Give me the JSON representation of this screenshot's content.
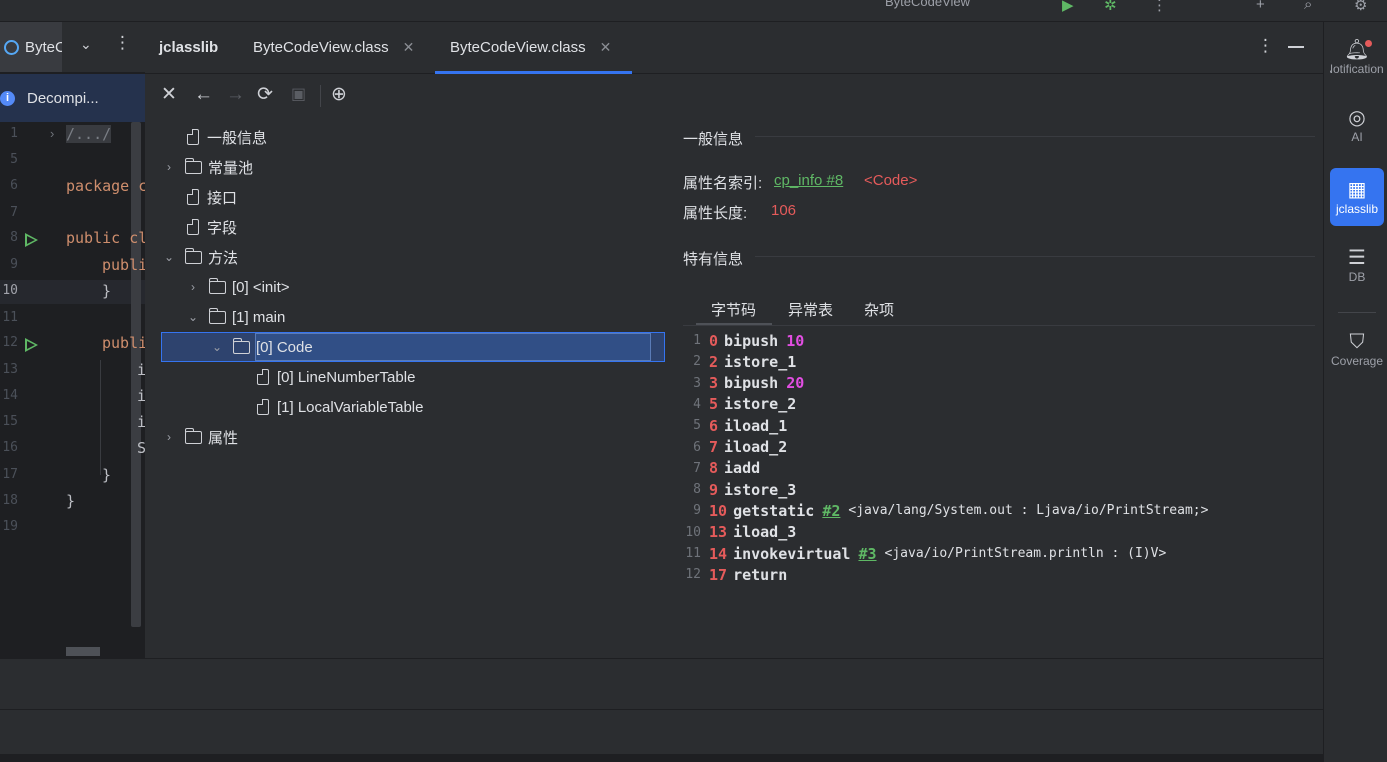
{
  "topbar": {
    "run_config": "ByteCodeView"
  },
  "editor": {
    "tab_label": "ByteCodeView.java",
    "banner": "Decompi...",
    "lines": [
      {
        "num": "1",
        "text": "/.../"
      },
      {
        "num": "5",
        "text": ""
      },
      {
        "num": "6",
        "text": "package c"
      },
      {
        "num": "7",
        "text": ""
      },
      {
        "num": "8",
        "text": "public cl"
      },
      {
        "num": "9",
        "text": "publi"
      },
      {
        "num": "10",
        "text": "}"
      },
      {
        "num": "11",
        "text": ""
      },
      {
        "num": "12",
        "text": "publi"
      },
      {
        "num": "13",
        "text": "i"
      },
      {
        "num": "14",
        "text": "i"
      },
      {
        "num": "15",
        "text": "i"
      },
      {
        "num": "16",
        "text": "S"
      },
      {
        "num": "17",
        "text": "}"
      },
      {
        "num": "18",
        "text": "}"
      },
      {
        "num": "19",
        "text": ""
      }
    ]
  },
  "jclasslib": {
    "title": "jclasslib",
    "tabs": [
      "ByteCodeView.class",
      "ByteCodeView.class"
    ],
    "tree": {
      "general_info": "一般信息",
      "constant_pool": "常量池",
      "interfaces": "接口",
      "fields": "字段",
      "methods": "方法",
      "method_init": "[0] <init>",
      "method_main": "[1] main",
      "code": "[0] Code",
      "line_number_table": "[0] LineNumberTable",
      "local_variable_table": "[1] LocalVariableTable",
      "attributes": "属性"
    },
    "details": {
      "general_header": "一般信息",
      "attr_name_index_label": "属性名索引:",
      "attr_name_index_link": "cp_info #8",
      "attr_name_index_value": "<Code>",
      "attr_length_label": "属性长度:",
      "attr_length_value": "106",
      "specific_header": "特有信息",
      "tabs": [
        "字节码",
        "异常表",
        "杂项"
      ],
      "bytecode": [
        {
          "line": "1",
          "offset": "0",
          "op": "bipush",
          "arg": "10",
          "ref": "",
          "comment": ""
        },
        {
          "line": "2",
          "offset": "2",
          "op": "istore_1",
          "arg": "",
          "ref": "",
          "comment": ""
        },
        {
          "line": "3",
          "offset": "3",
          "op": "bipush",
          "arg": "20",
          "ref": "",
          "comment": ""
        },
        {
          "line": "4",
          "offset": "5",
          "op": "istore_2",
          "arg": "",
          "ref": "",
          "comment": ""
        },
        {
          "line": "5",
          "offset": "6",
          "op": "iload_1",
          "arg": "",
          "ref": "",
          "comment": ""
        },
        {
          "line": "6",
          "offset": "7",
          "op": "iload_2",
          "arg": "",
          "ref": "",
          "comment": ""
        },
        {
          "line": "7",
          "offset": "8",
          "op": "iadd",
          "arg": "",
          "ref": "",
          "comment": ""
        },
        {
          "line": "8",
          "offset": "9",
          "op": "istore_3",
          "arg": "",
          "ref": "",
          "comment": ""
        },
        {
          "line": "9",
          "offset": "10",
          "op": "getstatic",
          "arg": "",
          "ref": "#2",
          "comment": "<java/lang/System.out : Ljava/io/PrintStream;>"
        },
        {
          "line": "10",
          "offset": "13",
          "op": "iload_3",
          "arg": "",
          "ref": "",
          "comment": ""
        },
        {
          "line": "11",
          "offset": "14",
          "op": "invokevirtual",
          "arg": "",
          "ref": "#3",
          "comment": "<java/io/PrintStream.println : (I)V>"
        },
        {
          "line": "12",
          "offset": "17",
          "op": "return",
          "arg": "",
          "ref": "",
          "comment": ""
        }
      ]
    }
  },
  "rightbar": {
    "items": [
      {
        "label": "Notifications",
        "icon": "bell-icon"
      },
      {
        "label": "AI",
        "icon": "ai-icon"
      },
      {
        "label": "jclasslib",
        "icon": "jclasslib-icon"
      },
      {
        "label": "DB",
        "icon": "database-icon"
      },
      {
        "label": "Coverage",
        "icon": "shield-icon"
      }
    ]
  },
  "colors": {
    "accent": "#3574f0",
    "offset_red": "#e55b5b",
    "ref_green": "#5fb865",
    "arg_magenta": "#e24ee2"
  }
}
